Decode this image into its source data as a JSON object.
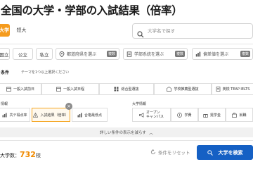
{
  "header": {
    "title": "全国の大学・学部の入試結果（倍率）"
  },
  "tabs": [
    {
      "label": "大学",
      "active": true
    },
    {
      "label": "短大",
      "active": false
    }
  ],
  "search": {
    "placeholder": "大学名で探す"
  },
  "filters": {
    "type_buttons": [
      "国立",
      "公立",
      "私立"
    ],
    "selects": [
      {
        "placeholder": "都道府県を選ぶ",
        "badge": "複数"
      },
      {
        "placeholder": "学部系統を選ぶ",
        "badge": "複数"
      },
      {
        "placeholder": "偏差値を選ぶ",
        "badge": "複数"
      }
    ]
  },
  "conditions": {
    "title": "条件",
    "note": "テーマを1つ以上選択ください",
    "exam_options": [
      "一般入試前日",
      "一般入試日程",
      "総合型選抜",
      "学校推薦型選抜",
      "英検 TEAP IELTS"
    ],
    "left_section_label": "情報",
    "right_section_label": "大学情報",
    "left_tiles": [
      {
        "label": "共テ得点率",
        "active": false
      },
      {
        "label": "入試結果（倍率）",
        "active": true
      },
      {
        "label": "合格最低点",
        "active": false
      }
    ],
    "right_tiles": [
      {
        "line1": "オープン",
        "line2": "キャンパス"
      },
      {
        "label": "学費"
      },
      {
        "label": "奨学金"
      },
      {
        "label": "就職"
      }
    ],
    "active_close": "×",
    "more_link": "詳しい条件の表示を減らす"
  },
  "footer": {
    "count_label": "大学数：",
    "count_value": "732",
    "count_unit": "校",
    "reset_label": "条件をリセット",
    "search_button": "大学を検索"
  },
  "colors": {
    "accent_orange": "#f59b1d",
    "count_orange": "#f08a00",
    "primary_blue": "#1560c4",
    "active_tile_border": "#f5a623"
  }
}
